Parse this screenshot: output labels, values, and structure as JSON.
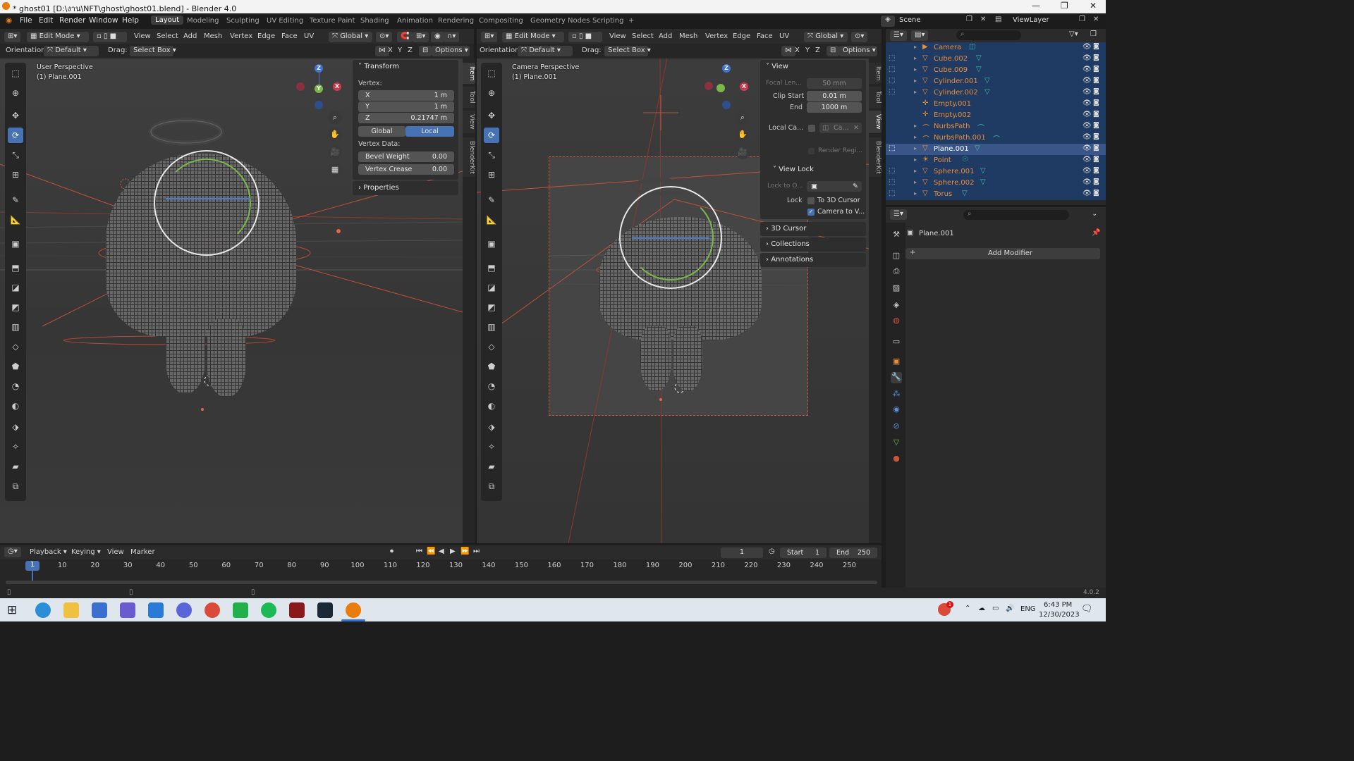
{
  "window": {
    "title": "* ghost01 [D:\\งาน\\NFT\\ghost\\ghost01.blend] - Blender 4.0",
    "controls": [
      "—",
      "❐",
      "✕"
    ]
  },
  "menu": {
    "items": [
      "File",
      "Edit",
      "Render",
      "Window",
      "Help"
    ]
  },
  "workspaces": [
    "Layout",
    "Modeling",
    "Sculpting",
    "UV Editing",
    "Texture Paint",
    "Shading",
    "Animation",
    "Rendering",
    "Compositing",
    "Geometry Nodes",
    "Scripting"
  ],
  "scene": {
    "scene_label": "Scene",
    "viewlayer_label": "ViewLayer"
  },
  "left_viewport": {
    "mode": "Edit Mode",
    "menus": [
      "View",
      "Select",
      "Add",
      "Mesh",
      "Vertex",
      "Edge",
      "Face",
      "UV"
    ],
    "transform_space": "Global",
    "orientation_label": "Orientation:",
    "orientation_value": "Default",
    "drag_label": "Drag:",
    "drag_value": "Select Box",
    "axes": [
      "X",
      "Y",
      "Z"
    ],
    "options": "Options",
    "view_name": "User Perspective",
    "object_name": "(1) Plane.001",
    "npanel": {
      "title": "Transform",
      "vertex_label": "Vertex:",
      "x_label": "X",
      "x_value": "1 m",
      "y_label": "Y",
      "y_value": "1 m",
      "z_label": "Z",
      "z_value": "0.21747 m",
      "global": "Global",
      "local": "Local",
      "vertex_data": "Vertex Data:",
      "bevel_label": "Bevel Weight",
      "bevel_value": "0.00",
      "crease_label": "Vertex Crease",
      "crease_value": "0.00",
      "properties": "Properties"
    },
    "tabs": [
      "Item",
      "Tool",
      "View",
      "BlenderKit"
    ]
  },
  "right_viewport": {
    "mode": "Edit Mode",
    "menus": [
      "View",
      "Select",
      "Add",
      "Mesh",
      "Vertex",
      "Edge",
      "Face",
      "UV"
    ],
    "transform_space": "Global",
    "orientation_label": "Orientation:",
    "orientation_value": "Default",
    "drag_label": "Drag:",
    "drag_value": "Select Box",
    "axes": [
      "X",
      "Y",
      "Z"
    ],
    "options": "Options",
    "view_name": "Camera Perspective",
    "object_name": "(1) Plane.001",
    "npanel": {
      "view_title": "View",
      "focal_label": "Focal Len...",
      "focal_value": "50 mm",
      "clip_start_label": "Clip Start",
      "clip_start_value": "0.01 m",
      "end_label": "End",
      "end_value": "1000 m",
      "local_cam_label": "Local Ca...",
      "local_cam_value": "Ca...",
      "render_region": "Render Regi...",
      "view_lock": "View Lock",
      "lock_to_label": "Lock to O...",
      "lock_label": "Lock",
      "to_cursor": "To 3D Cursor",
      "camera_to_view": "Camera to V...",
      "cursor_3d": "3D Cursor",
      "collections": "Collections",
      "annotations": "Annotations"
    },
    "tabs": [
      "Item",
      "Tool",
      "View",
      "BlenderKit"
    ]
  },
  "outliner": {
    "items": [
      {
        "name": "Camera"
      },
      {
        "name": "Cube.002"
      },
      {
        "name": "Cube.009"
      },
      {
        "name": "Cylinder.001"
      },
      {
        "name": "Cylinder.002"
      },
      {
        "name": "Empty.001"
      },
      {
        "name": "Empty.002"
      },
      {
        "name": "NurbsPath"
      },
      {
        "name": "NurbsPath.001"
      },
      {
        "name": "Plane.001"
      },
      {
        "name": "Point"
      },
      {
        "name": "Sphere.001"
      },
      {
        "name": "Sphere.002"
      },
      {
        "name": "Torus"
      }
    ]
  },
  "properties": {
    "object_name": "Plane.001",
    "add_modifier": "Add Modifier"
  },
  "timeline": {
    "menus": [
      "Playback",
      "Keying",
      "View",
      "Marker"
    ],
    "current_frame": "1",
    "start_label": "Start",
    "start_value": "1",
    "end_label": "End",
    "end_value": "250",
    "ticks": [
      "1",
      "10",
      "20",
      "30",
      "40",
      "50",
      "60",
      "70",
      "80",
      "90",
      "100",
      "110",
      "120",
      "130",
      "140",
      "150",
      "160",
      "170",
      "180",
      "190",
      "200",
      "210",
      "220",
      "230",
      "240",
      "250"
    ]
  },
  "status": {
    "version": "4.0.2"
  },
  "taskbar": {
    "lang": "ENG",
    "time": "6:43 PM",
    "date": "12/30/2023",
    "notif_count": "1"
  }
}
